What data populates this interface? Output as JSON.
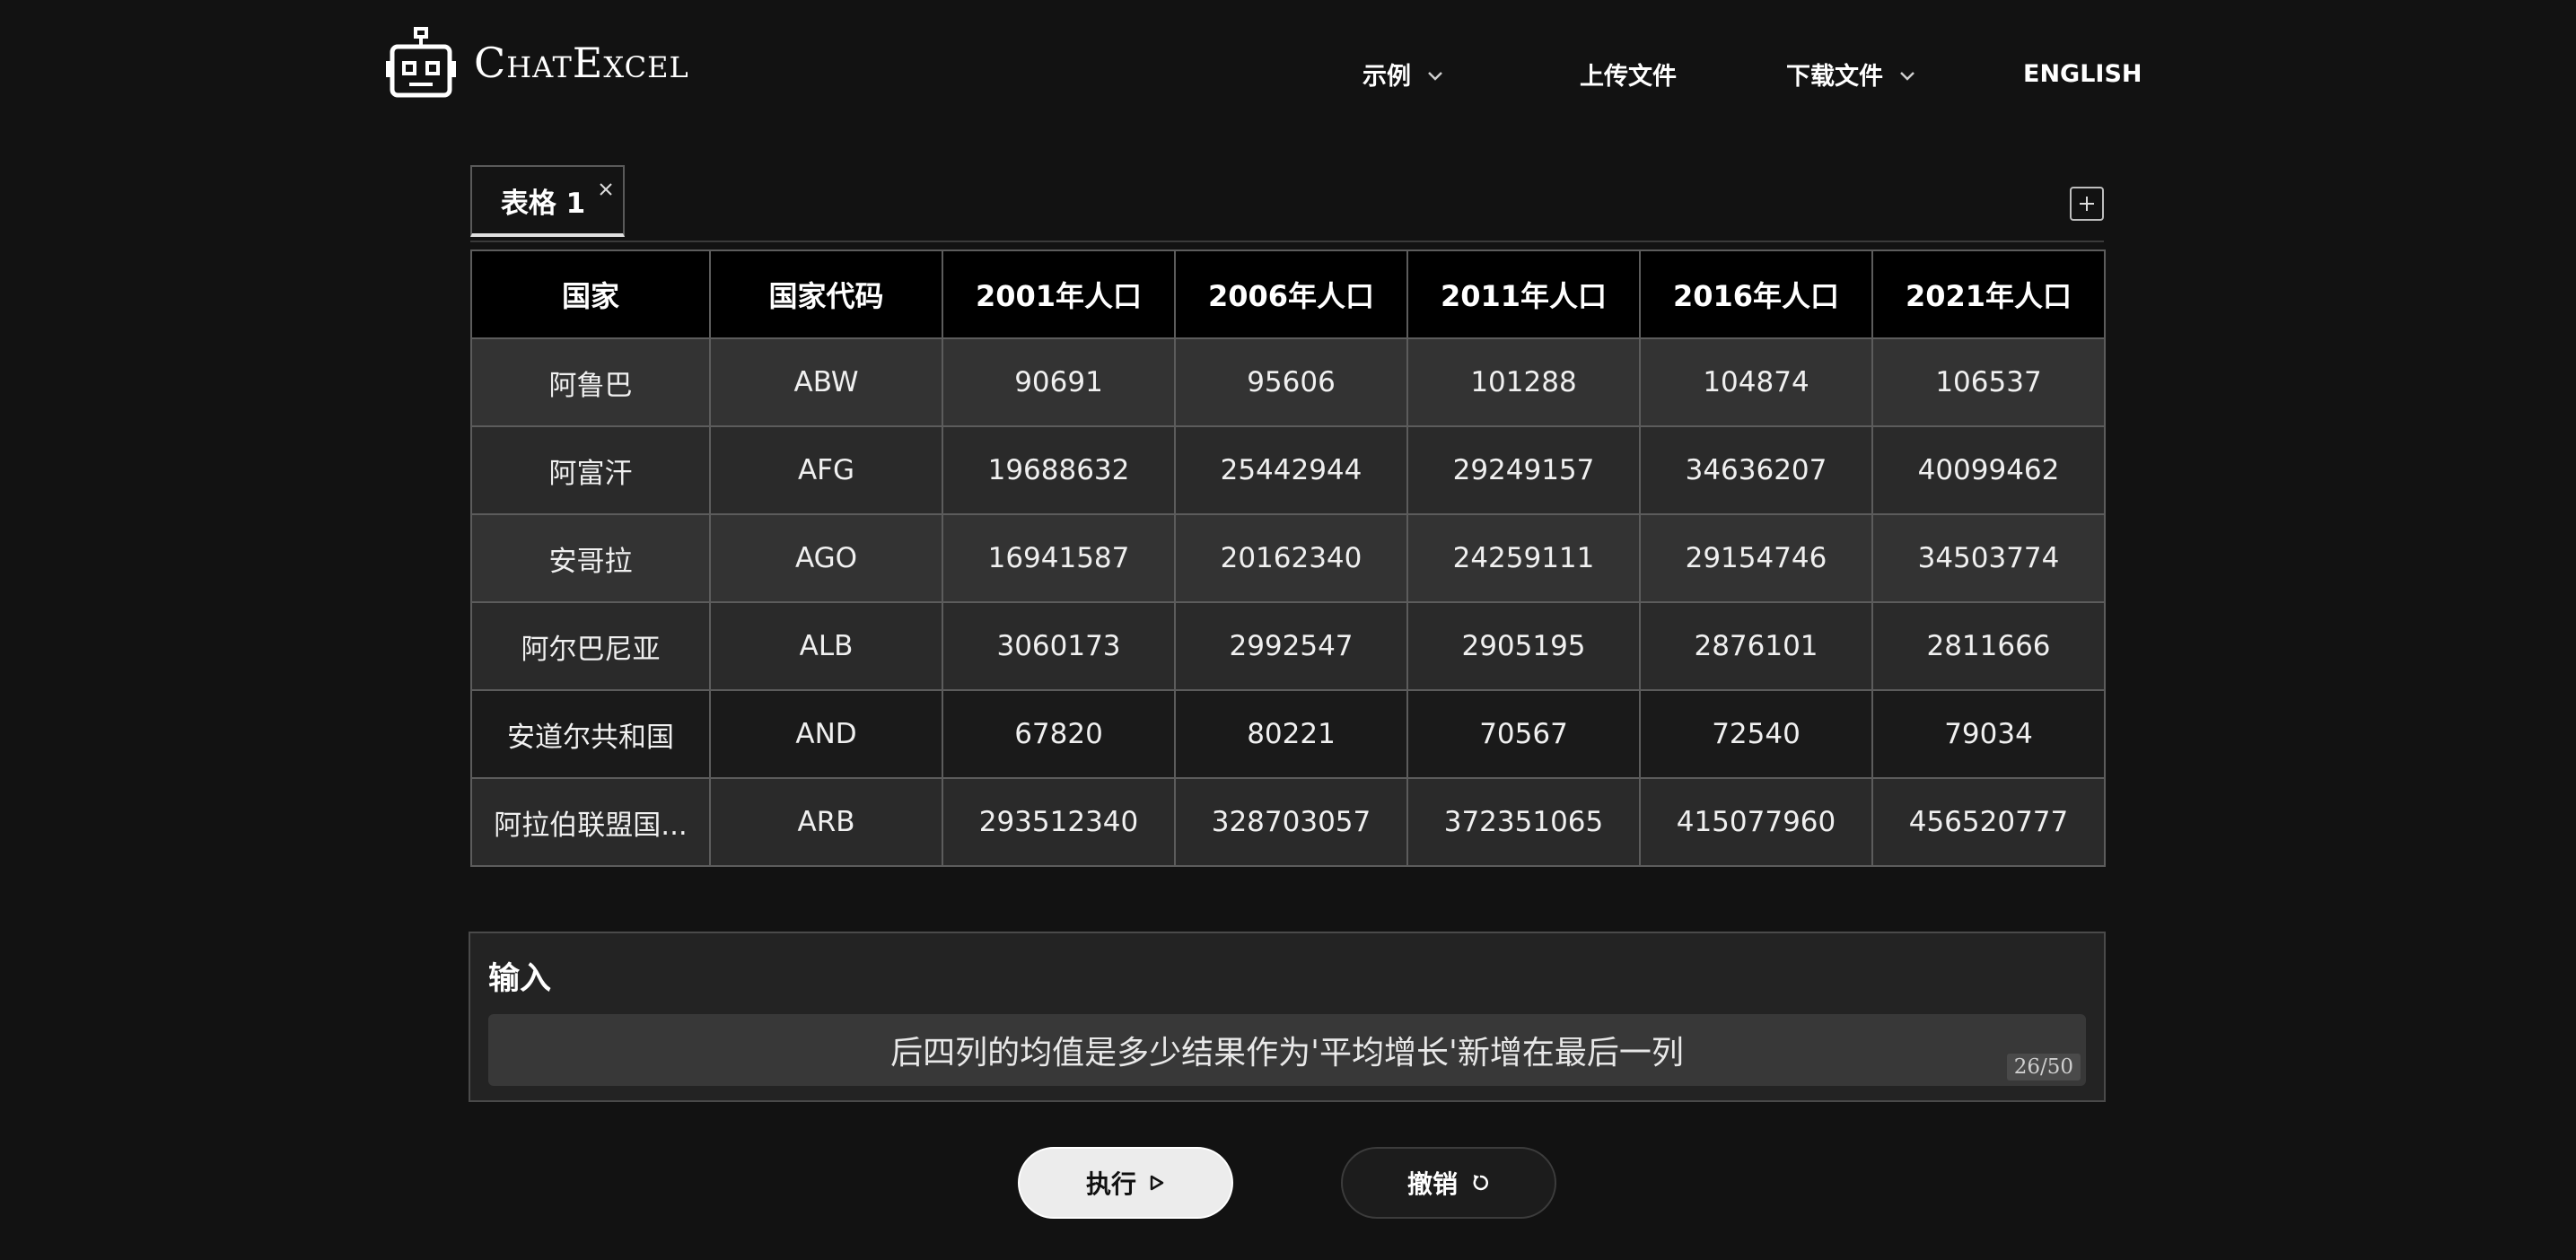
{
  "header": {
    "logo_text": "ChatExcel",
    "nav": {
      "examples": "示例",
      "upload": "上传文件",
      "download": "下载文件",
      "language": "ENGLISH"
    }
  },
  "tabs": [
    {
      "label": "表格 1"
    }
  ],
  "table": {
    "columns": [
      "国家",
      "国家代码",
      "2001年人口",
      "2006年人口",
      "2011年人口",
      "2016年人口",
      "2021年人口"
    ],
    "rows": [
      [
        "阿鲁巴",
        "ABW",
        "90691",
        "95606",
        "101288",
        "104874",
        "106537"
      ],
      [
        "阿富汗",
        "AFG",
        "19688632",
        "25442944",
        "29249157",
        "34636207",
        "40099462"
      ],
      [
        "安哥拉",
        "AGO",
        "16941587",
        "20162340",
        "24259111",
        "29154746",
        "34503774"
      ],
      [
        "阿尔巴尼亚",
        "ALB",
        "3060173",
        "2992547",
        "2905195",
        "2876101",
        "2811666"
      ],
      [
        "安道尔共和国",
        "AND",
        "67820",
        "80221",
        "70567",
        "72540",
        "79034"
      ],
      [
        "阿拉伯联盟国...",
        "ARB",
        "293512340",
        "328703057",
        "372351065",
        "415077960",
        "456520777"
      ]
    ]
  },
  "input": {
    "title": "输入",
    "value": "后四列的均值是多少结果作为'平均增长'新增在最后一列",
    "char_count": "26/50"
  },
  "buttons": {
    "run": "执行",
    "undo": "撤销"
  }
}
